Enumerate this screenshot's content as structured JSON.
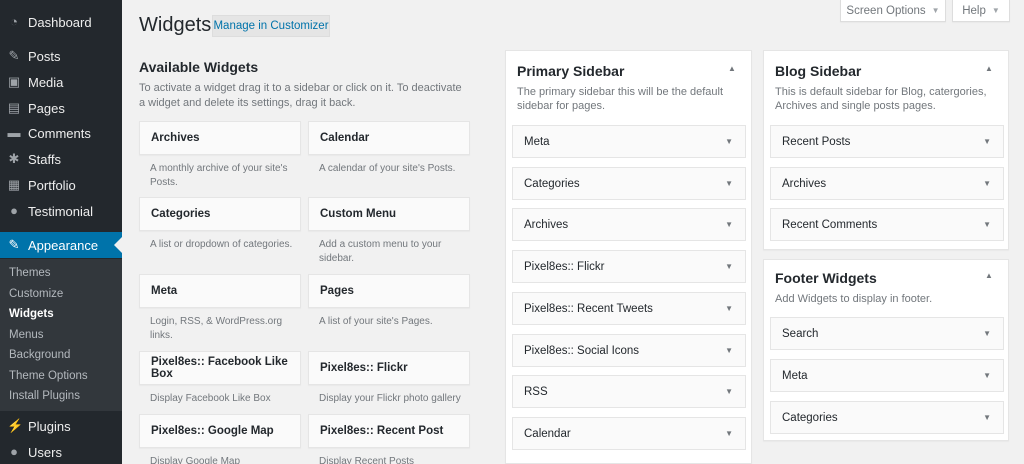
{
  "admin_menu": {
    "items": [
      {
        "label": "Dashboard",
        "icon": "dashboard-icon",
        "glyph": "◔"
      },
      {
        "label": "Posts",
        "icon": "pushpin-icon",
        "glyph": "✎"
      },
      {
        "label": "Media",
        "icon": "media-icon",
        "glyph": "▣"
      },
      {
        "label": "Pages",
        "icon": "pages-icon",
        "glyph": "▤"
      },
      {
        "label": "Comments",
        "icon": "comments-icon",
        "glyph": "▬"
      },
      {
        "label": "Staffs",
        "icon": "staffs-icon",
        "glyph": "✱"
      },
      {
        "label": "Portfolio",
        "icon": "portfolio-icon",
        "glyph": "▦"
      },
      {
        "label": "Testimonial",
        "icon": "testimonial-icon",
        "glyph": "●"
      },
      {
        "label": "Appearance",
        "icon": "paintbrush-icon",
        "glyph": "✎"
      },
      {
        "label": "Plugins",
        "icon": "plugins-icon",
        "glyph": "⚡"
      },
      {
        "label": "Users",
        "icon": "users-icon",
        "glyph": "●"
      }
    ],
    "submenu": [
      "Themes",
      "Customize",
      "Widgets",
      "Menus",
      "Background",
      "Theme Options",
      "Install Plugins"
    ]
  },
  "header": {
    "title": "Widgets",
    "manage_button": "Manage in Customizer",
    "screen_options": "Screen Options",
    "help": "Help",
    "dropdown_glyph": "▼"
  },
  "available": {
    "title": "Available Widgets",
    "description": "To activate a widget drag it to a sidebar or click on it. To deactivate a widget and delete its settings, drag it back.",
    "widgets": [
      {
        "name": "Archives",
        "desc": "A monthly archive of your site's Posts."
      },
      {
        "name": "Calendar",
        "desc": "A calendar of your site's Posts."
      },
      {
        "name": "Categories",
        "desc": "A list or dropdown of categories."
      },
      {
        "name": "Custom Menu",
        "desc": "Add a custom menu to your sidebar."
      },
      {
        "name": "Meta",
        "desc": "Login, RSS, & WordPress.org links."
      },
      {
        "name": "Pages",
        "desc": "A list of your site's Pages."
      },
      {
        "name": "Pixel8es:: Facebook Like Box",
        "desc": "Display Facebook Like Box"
      },
      {
        "name": "Pixel8es:: Flickr",
        "desc": "Display your Flickr photo gallery"
      },
      {
        "name": "Pixel8es:: Google Map",
        "desc": "Display Google Map"
      },
      {
        "name": "Pixel8es:: Recent Post",
        "desc": "Display Recent Posts"
      }
    ]
  },
  "areas": {
    "toggle_glyph": "▲",
    "arrow_glyph": "▼",
    "primary": {
      "title": "Primary Sidebar",
      "description": "The primary sidebar this will be the default sidebar for pages.",
      "widgets": [
        "Meta",
        "Categories",
        "Archives",
        "Pixel8es:: Flickr",
        "Pixel8es:: Recent Tweets",
        "Pixel8es:: Social Icons",
        "RSS",
        "Calendar"
      ]
    },
    "blog": {
      "title": "Blog Sidebar",
      "description": "This is default sidebar for Blog, catergories, Archives and single posts pages.",
      "widgets": [
        "Recent Posts",
        "Archives",
        "Recent Comments"
      ]
    },
    "footer": {
      "title": "Footer Widgets",
      "description": "Add Widgets to display in footer.",
      "widgets": [
        "Search",
        "Meta",
        "Categories"
      ]
    }
  }
}
